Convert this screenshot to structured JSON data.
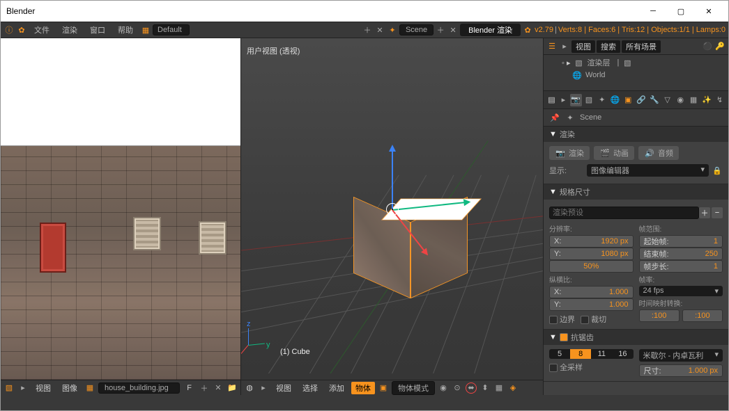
{
  "title": "Blender",
  "topbar": {
    "blender_icon": "✿",
    "menus": [
      "文件",
      "渲染",
      "窗口",
      "帮助"
    ],
    "layout": "Default",
    "scene": "Scene",
    "engine": "Blender 渲染",
    "version": "v2.79",
    "stats": "Verts:8 | Faces:6 | Tris:12 | Objects:1/1 | Lamps:0"
  },
  "uv": {
    "menus": [
      "视图",
      "图像"
    ],
    "file": "house_building.jpg",
    "flag": "F"
  },
  "viewport": {
    "label": "用户视图 (透视)",
    "info": "(1) Cube",
    "menus": [
      "视图",
      "选择",
      "添加",
      "物体"
    ],
    "mode": "物体模式"
  },
  "outliner": {
    "tabs": [
      "视图",
      "搜索",
      "所有场景"
    ],
    "rows": [
      "渲染层",
      "World"
    ]
  },
  "props": {
    "bread": "Scene",
    "render_h": "渲染",
    "btns": [
      "渲染",
      "动画",
      "音频"
    ],
    "display_lbl": "显示:",
    "display_val": "图像编辑器",
    "dim_h": "规格尺寸",
    "preset": "渲染预设",
    "res_lbl": "分辨率:",
    "res_x": {
      "k": "X:",
      "v": "1920 px"
    },
    "res_y": {
      "k": "Y:",
      "v": "1080 px"
    },
    "res_pct": "50%",
    "aspect_lbl": "纵横比:",
    "asp_x": {
      "k": "X:",
      "v": "1.000"
    },
    "asp_y": {
      "k": "Y:",
      "v": "1.000"
    },
    "border": "边界",
    "crop": "裁切",
    "range_lbl": "帧范围:",
    "start": {
      "k": "起始帧:",
      "v": "1"
    },
    "end": {
      "k": "结束帧:",
      "v": "250"
    },
    "step": {
      "k": "帧步长:",
      "v": "1"
    },
    "fps_lbl": "帧率:",
    "fps": "24 fps",
    "remap": "时间映射转换:",
    "remap_a": ":100",
    "remap_b": ":100",
    "aa_h": "抗锯齿",
    "aa_vals": [
      "5",
      "8",
      "11",
      "16"
    ],
    "aa_sel": "8",
    "filter": "米歇尔 - 内卓瓦利",
    "full": "全采样",
    "size": {
      "k": "尺寸:",
      "v": "1.000 px"
    }
  }
}
